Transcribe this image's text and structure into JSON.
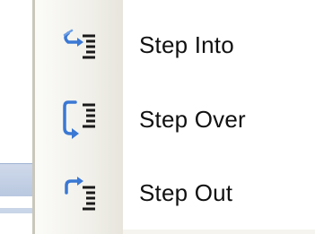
{
  "menu": {
    "items": [
      {
        "label": "Step Into",
        "icon": "step-into-icon"
      },
      {
        "label": "Step Over",
        "icon": "step-over-icon"
      },
      {
        "label": "Step Out",
        "icon": "step-out-icon"
      }
    ]
  },
  "colors": {
    "arrow": "#3a78d4",
    "lines": "#1a1a1a",
    "gutter": "#f1f0ea"
  }
}
